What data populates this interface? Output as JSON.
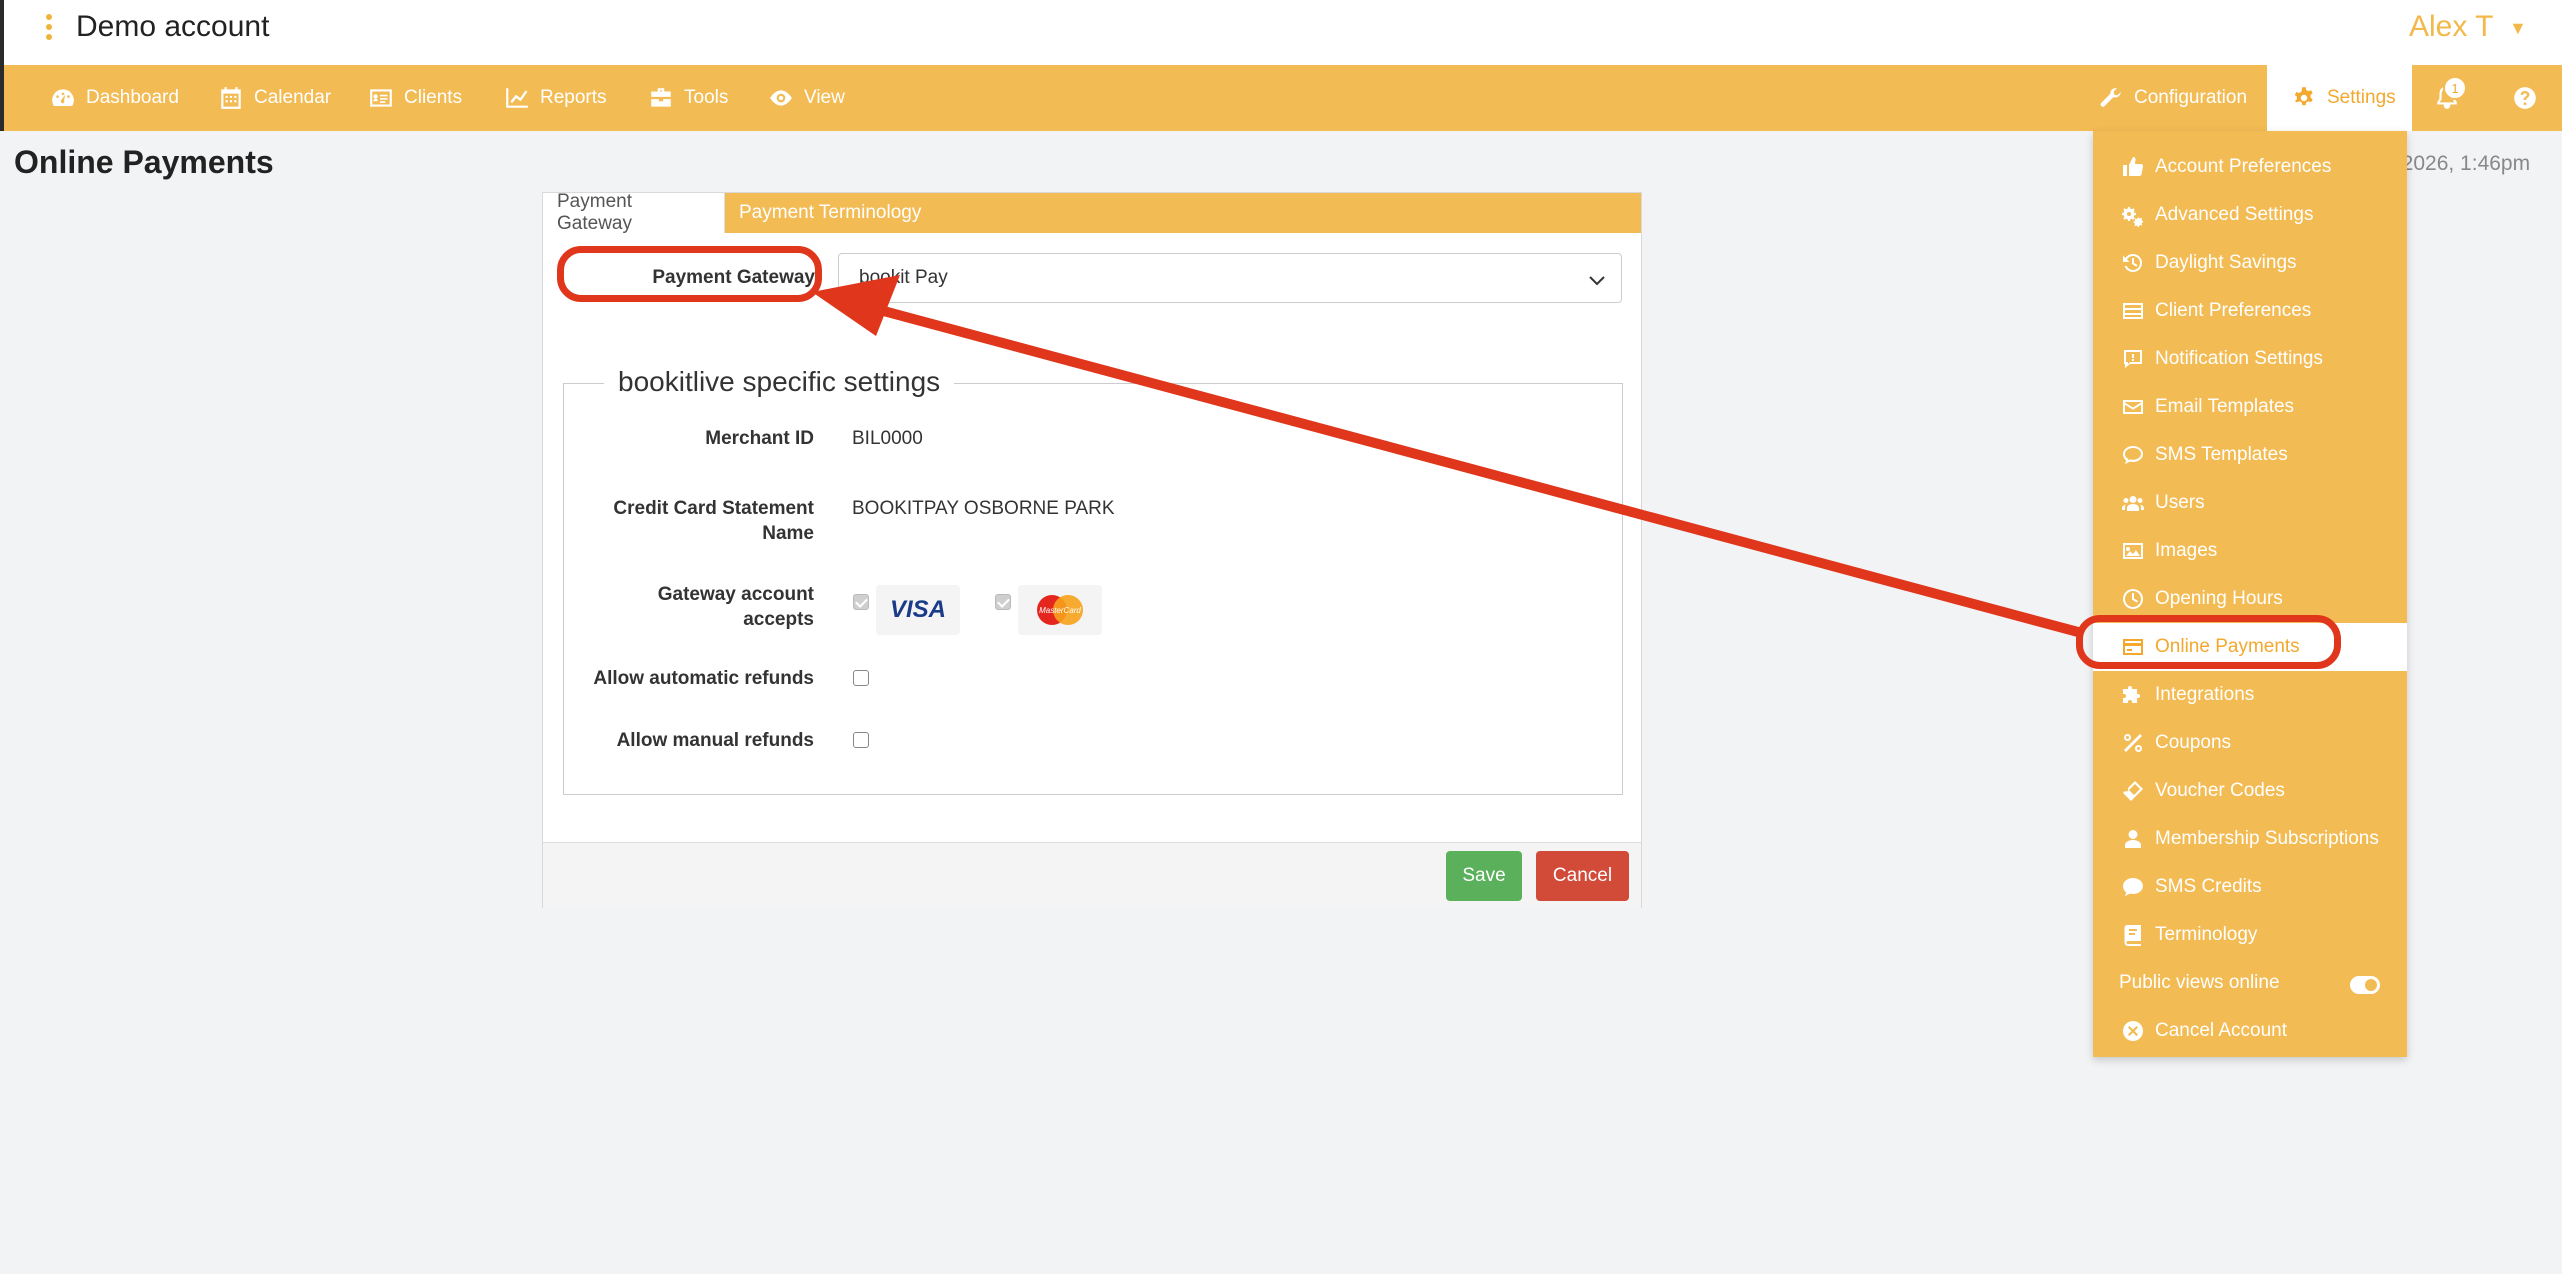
{
  "header": {
    "account_title": "Demo account",
    "user_name": "Alex T",
    "user_caret": "▼"
  },
  "nav": {
    "items": [
      {
        "label": "Dashboard",
        "icon": "dashboard-icon"
      },
      {
        "label": "Calendar",
        "icon": "calendar-icon"
      },
      {
        "label": "Clients",
        "icon": "clients-icon"
      },
      {
        "label": "Reports",
        "icon": "reports-icon"
      },
      {
        "label": "Tools",
        "icon": "toolbox-icon"
      },
      {
        "label": "View",
        "icon": "eye-icon"
      }
    ],
    "configuration_label": "Configuration",
    "settings_label": "Settings",
    "notification_count": "1"
  },
  "page": {
    "title": "Online Payments",
    "date_text": "t 2026, 1:46pm"
  },
  "tabs": {
    "gateway": "Payment Gateway",
    "terminology": "Payment Terminology"
  },
  "form": {
    "gateway_label": "Payment Gateway",
    "gateway_value": "bookit Pay",
    "legend": "bookitlive specific settings",
    "merchant_label": "Merchant ID",
    "merchant_value": "BIL0000",
    "statement_label_1": "Credit Card Statement",
    "statement_label_2": "Name",
    "statement_value": "BOOKITPAY OSBORNE PARK",
    "accepts_label_1": "Gateway account",
    "accepts_label_2": "accepts",
    "visa_text": "VISA",
    "mastercard_text": "MasterCard",
    "auto_refunds_label": "Allow automatic refunds",
    "manual_refunds_label": "Allow manual refunds"
  },
  "buttons": {
    "save": "Save",
    "cancel": "Cancel"
  },
  "settings_menu": {
    "items": [
      {
        "label": "Account Preferences",
        "icon": "thumbs-up-icon"
      },
      {
        "label": "Advanced Settings",
        "icon": "gears-icon"
      },
      {
        "label": "Daylight Savings",
        "icon": "history-icon"
      },
      {
        "label": "Client Preferences",
        "icon": "list-icon"
      },
      {
        "label": "Notification Settings",
        "icon": "notification-icon"
      },
      {
        "label": "Email Templates",
        "icon": "envelope-icon"
      },
      {
        "label": "SMS Templates",
        "icon": "comment-icon"
      },
      {
        "label": "Users",
        "icon": "users-icon"
      },
      {
        "label": "Images",
        "icon": "image-icon"
      },
      {
        "label": "Opening Hours",
        "icon": "clock-icon"
      },
      {
        "label": "Online Payments",
        "icon": "credit-card-icon"
      },
      {
        "label": "Integrations",
        "icon": "puzzle-icon"
      },
      {
        "label": "Coupons",
        "icon": "percent-icon"
      },
      {
        "label": "Voucher Codes",
        "icon": "ticket-icon"
      },
      {
        "label": "Membership Subscriptions",
        "icon": "user-icon"
      },
      {
        "label": "SMS Credits",
        "icon": "comment-solid-icon"
      },
      {
        "label": "Terminology",
        "icon": "book-icon"
      }
    ],
    "public_views_label": "Public views online",
    "cancel_account_label": "Cancel Account"
  },
  "colors": {
    "accent": "#f3bb53",
    "accent_text": "#f3a82e",
    "annotation": "#e0361c",
    "save": "#5bb05b",
    "cancel": "#d24a38"
  }
}
